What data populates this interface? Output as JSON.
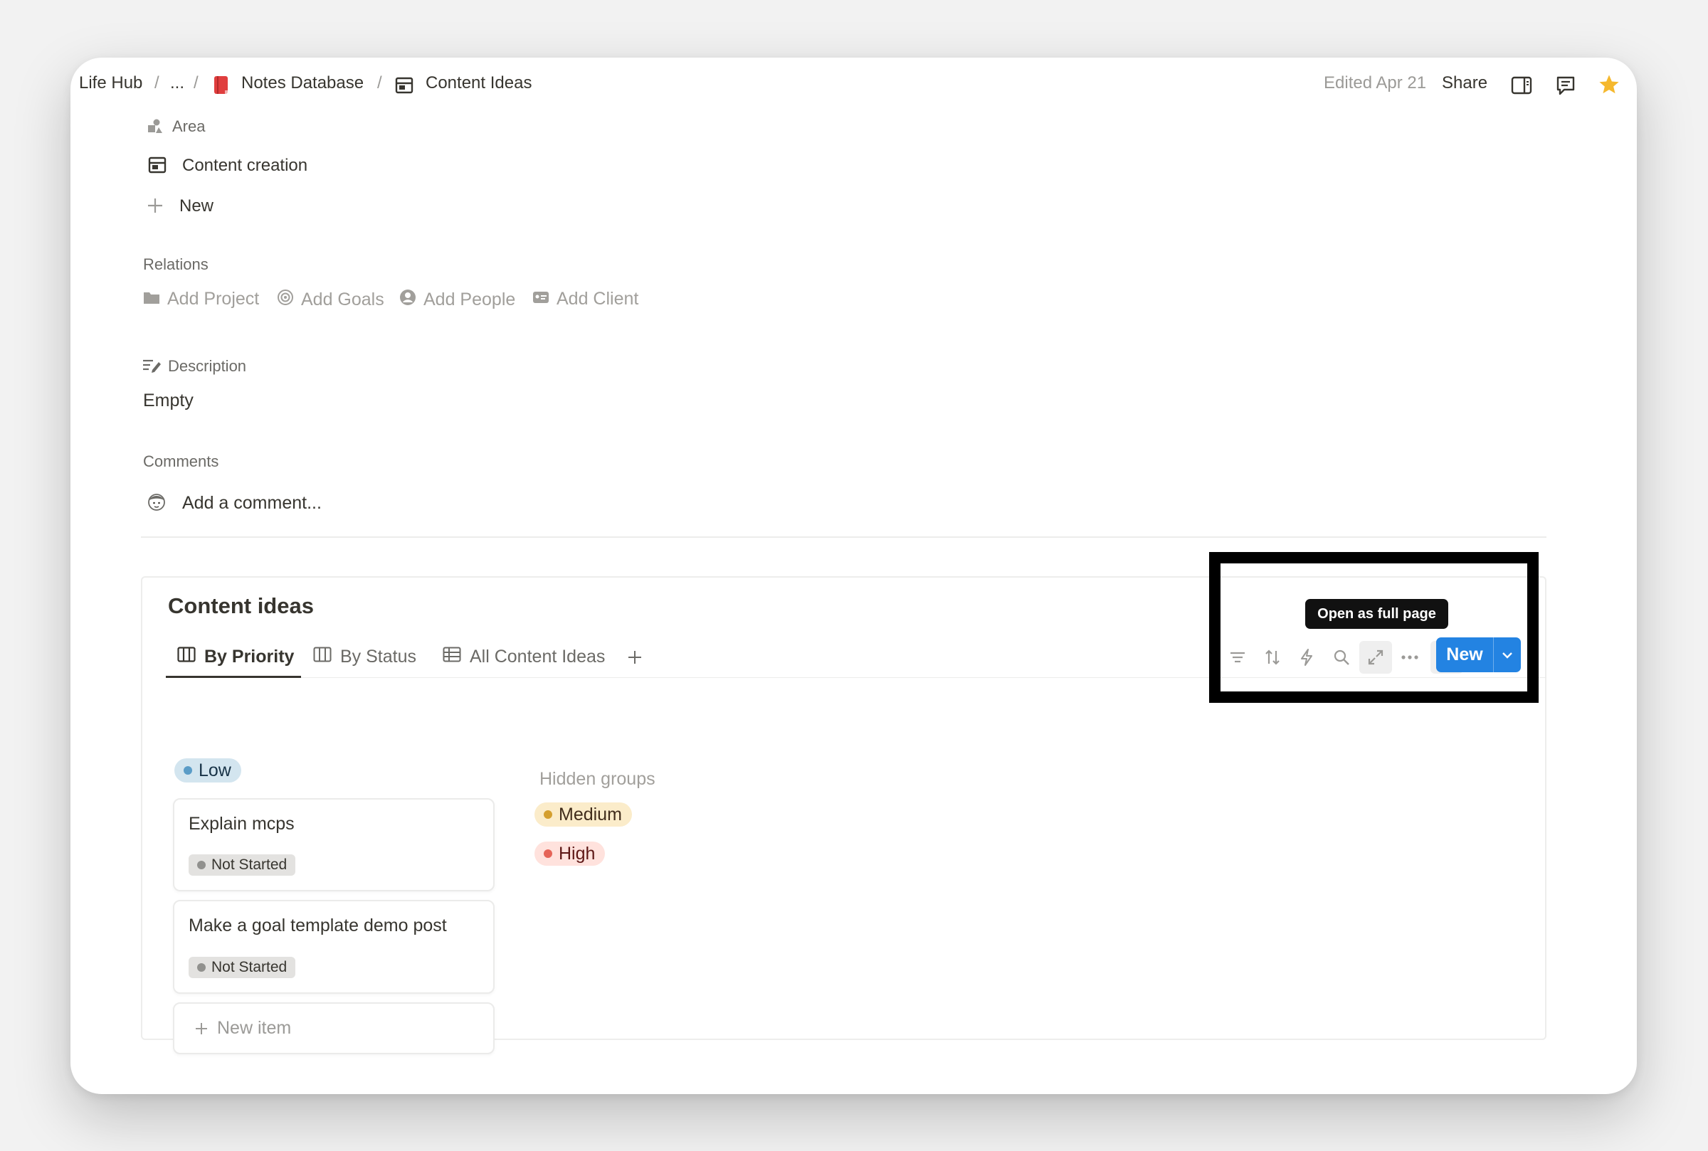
{
  "breadcrumb": {
    "items": [
      "Life Hub",
      "...",
      "Notes Database",
      "Content Ideas"
    ],
    "separator": "/"
  },
  "topbar": {
    "edited": "Edited Apr 21",
    "share_label": "Share",
    "icons": [
      "sidebar-panel-icon",
      "comment-icon",
      "star-icon"
    ]
  },
  "properties": {
    "area_label": "Area",
    "area_value": "Content creation",
    "new_label": "New",
    "relations_heading": "Relations",
    "relations": [
      "Add Project",
      "Add Goals",
      "Add People",
      "Add Client"
    ],
    "description_label": "Description",
    "description_value": "Empty",
    "comments_heading": "Comments",
    "comment_placeholder": "Add a comment..."
  },
  "database": {
    "title": "Content ideas",
    "tabs": [
      {
        "label": "By Priority",
        "icon": "board-icon",
        "active": true
      },
      {
        "label": "By Status",
        "icon": "board-icon",
        "active": false
      },
      {
        "label": "All Content Ideas",
        "icon": "table-icon",
        "active": false
      }
    ],
    "toolbar_icons": [
      "filter-icon",
      "sort-icon",
      "automation-icon",
      "search-icon",
      "expand-icon",
      "more-icon"
    ],
    "tooltip": "Open as full page",
    "new_button": "New",
    "groups": {
      "visible": {
        "name": "Low",
        "color": "#d3e5ef",
        "dot": "#5a9cc7",
        "cards": [
          {
            "title": "Explain mcps",
            "status": "Not Started"
          },
          {
            "title": "Make a goal template demo post",
            "status": "Not Started"
          }
        ],
        "new_item": "New item"
      },
      "hidden_label": "Hidden groups",
      "hidden": [
        {
          "name": "Medium",
          "color": "#fbecca",
          "dot": "#d49f2f"
        },
        {
          "name": "High",
          "color": "#ffe2dd",
          "dot": "#e56458"
        }
      ]
    }
  },
  "colors": {
    "accent_blue": "#2383e2",
    "star": "#f5b82e",
    "book_red": "#e03e3e"
  }
}
